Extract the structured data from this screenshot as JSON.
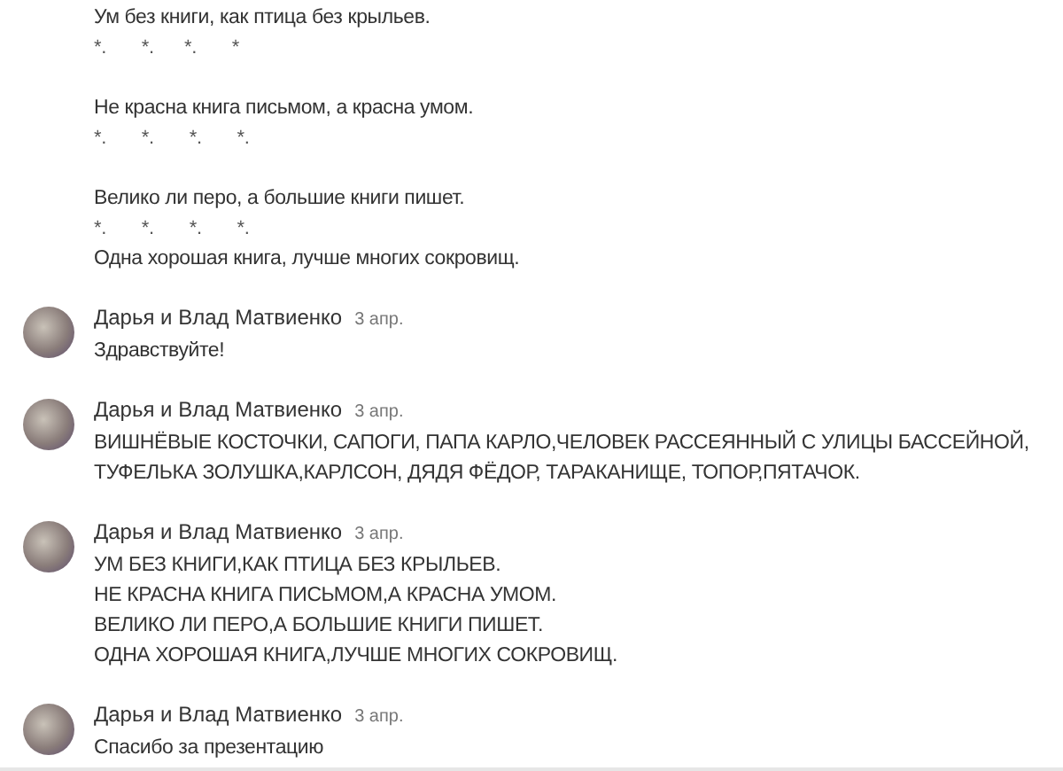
{
  "continued_comment": {
    "lines": [
      {
        "kind": "text",
        "text": "Ум без книги, как птица без крыльев."
      },
      {
        "kind": "marks",
        "text": "*.       *.      *.       *"
      },
      {
        "kind": "blank"
      },
      {
        "kind": "text",
        "text": "Не красна книга письмом, а красна умом."
      },
      {
        "kind": "marks",
        "text": "*.       *.       *.       *."
      },
      {
        "kind": "blank"
      },
      {
        "kind": "text",
        "text": "Велико ли перо, а большие книги пишет."
      },
      {
        "kind": "marks",
        "text": "*.       *.       *.       *."
      },
      {
        "kind": "text",
        "text": "Одна хорошая книга, лучше многих сокровищ."
      }
    ]
  },
  "comments": [
    {
      "author": "Дарья и Влад Матвиенко",
      "date": "3 апр.",
      "lines": [
        "Здравствуйте!"
      ]
    },
    {
      "author": "Дарья и Влад Матвиенко",
      "date": "3 апр.",
      "lines": [
        "ВИШНЁВЫЕ КОСТОЧКИ, САПОГИ, ПАПА КАРЛО,ЧЕЛОВЕК РАССЕЯННЫЙ С УЛИЦЫ БАССЕЙНОЙ,",
        "ТУФЕЛЬКА ЗОЛУШКА,КАРЛСОН, ДЯДЯ ФЁДОР, ТАРАКАНИЩЕ, ТОПОР,ПЯТАЧОК."
      ]
    },
    {
      "author": "Дарья и Влад Матвиенко",
      "date": "3 апр.",
      "lines": [
        "УМ БЕЗ КНИГИ,КАК ПТИЦА БЕЗ КРЫЛЬЕВ.",
        "НЕ КРАСНА КНИГА ПИСЬМОМ,А КРАСНА УМОМ.",
        "ВЕЛИКО ЛИ ПЕРО,А БОЛЬШИЕ КНИГИ ПИШЕТ.",
        "ОДНА ХОРОШАЯ КНИГА,ЛУЧШЕ МНОГИХ СОКРОВИЩ."
      ]
    },
    {
      "author": "Дарья и Влад Матвиенко",
      "date": "3 апр.",
      "lines": [
        "Спасибо за презентацию"
      ]
    }
  ]
}
